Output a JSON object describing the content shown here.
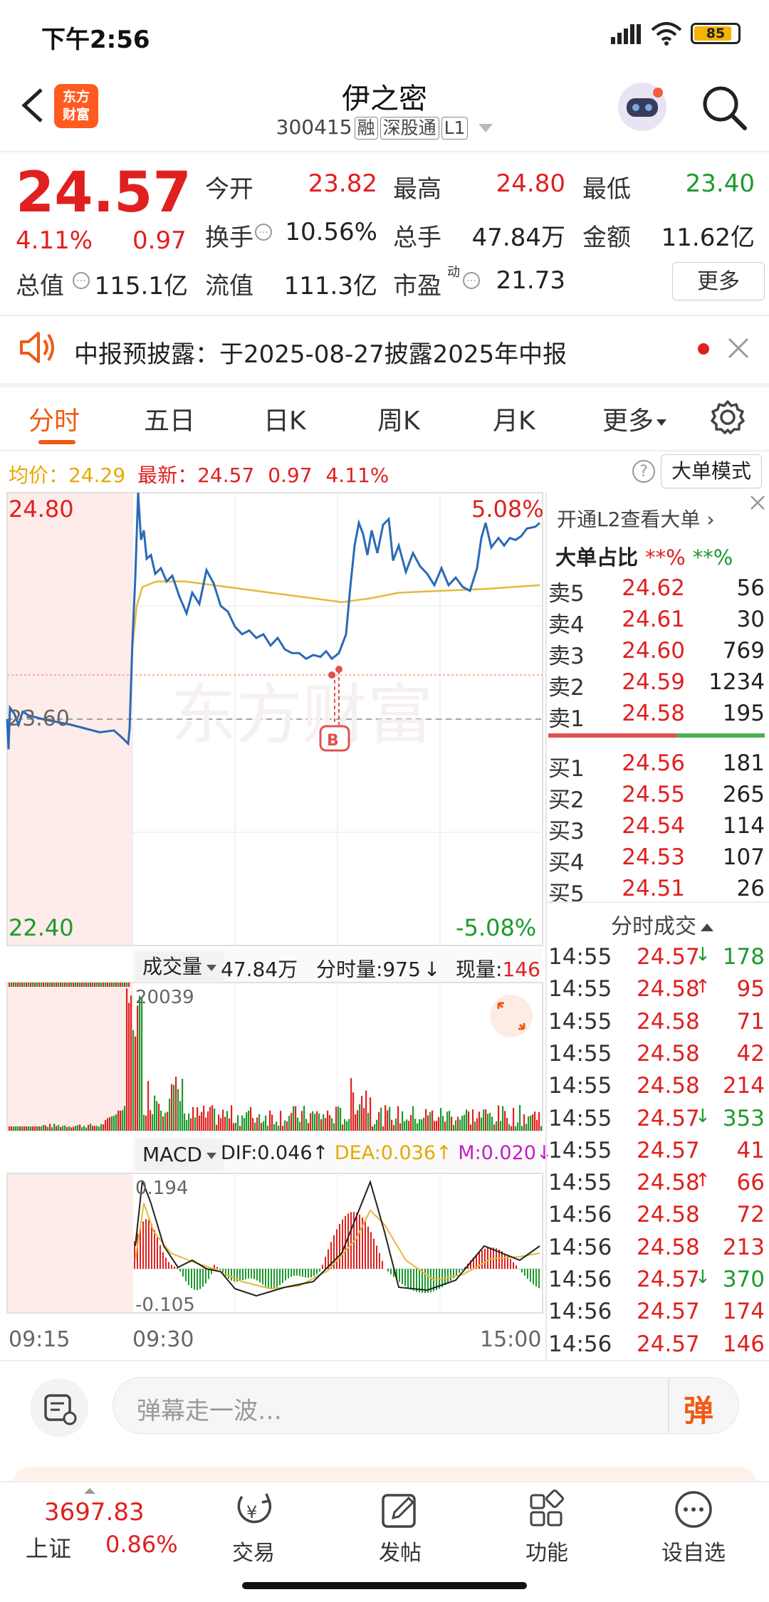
{
  "status_bar": {
    "time": "下午2:56",
    "battery": "85"
  },
  "header": {
    "logo_line1": "东方",
    "logo_line2": "财富",
    "stock_name": "伊之密",
    "stock_code": "300415",
    "tags": [
      "融",
      "深股通",
      "L1"
    ]
  },
  "quote": {
    "price": "24.57",
    "change_pct": "4.11%",
    "change": "0.97",
    "open_label": "今开",
    "open": "23.82",
    "high_label": "最高",
    "high": "24.80",
    "low_label": "最低",
    "low": "23.40",
    "turnover_label": "换手",
    "turnover": "10.56%",
    "volume_label": "总手",
    "volume": "47.84万",
    "amount_label": "金额",
    "amount": "11.62亿",
    "mktcap_label": "总值",
    "mktcap": "115.1亿",
    "float_label": "流值",
    "float": "111.3亿",
    "pe_label": "市盈",
    "pe_sup": "动",
    "pe": "21.73",
    "more": "更多"
  },
  "notice": {
    "text": "中报预披露：于2025-08-27披露2025年中报"
  },
  "tabs": [
    "分时",
    "五日",
    "日K",
    "周K",
    "月K",
    "更多"
  ],
  "info_line": {
    "avg_label": "均价：",
    "avg": "24.29",
    "latest_label": "最新：",
    "latest": "24.57",
    "chg": "0.97",
    "pct": "4.11%",
    "big_order_mode": "大单模式"
  },
  "chart": {
    "y_top": "24.80",
    "y_mid": "23.60",
    "y_bottom": "22.40",
    "pct_top": "5.08%",
    "pct_bottom": "-5.08%",
    "volume_label": "成交量",
    "volume_total": "47.84万",
    "fenshi_vol": "分时量:975",
    "fenshi_arrow": "↓",
    "cur_vol_label": "现量:",
    "cur_vol": "146",
    "vol_max": "20039",
    "macd_label": "MACD",
    "dif": "DIF:0.046",
    "dif_arrow": "↑",
    "dea": "DEA:0.036",
    "dea_arrow": "↑",
    "m": "M:0.020",
    "m_arrow": "↓",
    "macd_max": "0.194",
    "macd_min": "-0.105",
    "times": [
      "09:15",
      "09:30",
      "15:00"
    ],
    "colors": {
      "price": "#2a6ab5",
      "avg": "#e6b93a",
      "up": "#e02020",
      "down": "#1c9b2e"
    }
  },
  "order_book": {
    "l2_link": "开通L2查看大单",
    "big_ratio_label": "大单占比",
    "big_ratio_red": "**%",
    "big_ratio_green": "**%",
    "asks": [
      [
        "卖5",
        "24.62",
        "56"
      ],
      [
        "卖4",
        "24.61",
        "30"
      ],
      [
        "卖3",
        "24.60",
        "769"
      ],
      [
        "卖2",
        "24.59",
        "1234"
      ],
      [
        "卖1",
        "24.58",
        "195"
      ]
    ],
    "bids": [
      [
        "买1",
        "24.56",
        "181"
      ],
      [
        "买2",
        "24.55",
        "265"
      ],
      [
        "买3",
        "24.54",
        "114"
      ],
      [
        "买4",
        "24.53",
        "107"
      ],
      [
        "买5",
        "24.51",
        "26"
      ]
    ]
  },
  "trades": {
    "title": "分时成交",
    "rows": [
      [
        "14:55",
        "24.57",
        "↓",
        "178",
        "down"
      ],
      [
        "14:55",
        "24.58",
        "↑",
        "95",
        "up"
      ],
      [
        "14:55",
        "24.58",
        "",
        "71",
        "up"
      ],
      [
        "14:55",
        "24.58",
        "",
        "42",
        "up"
      ],
      [
        "14:55",
        "24.58",
        "",
        "214",
        "up"
      ],
      [
        "14:55",
        "24.57",
        "↓",
        "353",
        "down"
      ],
      [
        "14:55",
        "24.57",
        "",
        "41",
        "up"
      ],
      [
        "14:55",
        "24.58",
        "↑",
        "66",
        "up"
      ],
      [
        "14:56",
        "24.58",
        "",
        "72",
        "up"
      ],
      [
        "14:56",
        "24.58",
        "",
        "213",
        "up"
      ],
      [
        "14:56",
        "24.57",
        "↓",
        "370",
        "down"
      ],
      [
        "14:56",
        "24.57",
        "",
        "174",
        "up"
      ],
      [
        "14:56",
        "24.57",
        "",
        "146",
        "up"
      ]
    ]
  },
  "danmu": {
    "placeholder": "弹幕走一波…",
    "button": "弹"
  },
  "bottom_nav": {
    "index_value": "3697.83",
    "index_name": "上证",
    "index_pct": "0.86%",
    "items": [
      "交易",
      "发帖",
      "功能",
      "设自选"
    ]
  }
}
